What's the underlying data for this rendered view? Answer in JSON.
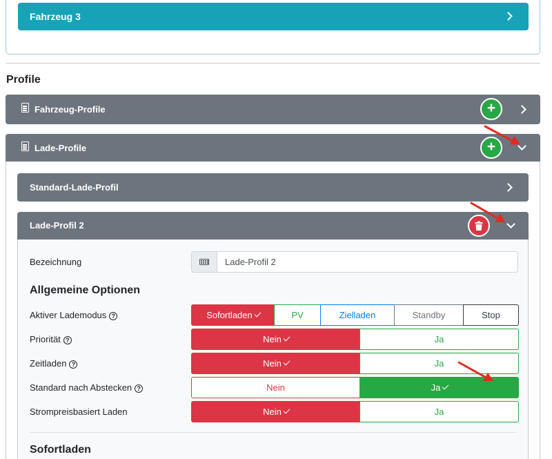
{
  "vehicle": {
    "title": "Fahrzeug 3"
  },
  "profiles_section": {
    "title": "Profile"
  },
  "vehicle_profiles": {
    "title": "Fahrzeug-Profile"
  },
  "charge_profiles": {
    "title": "Lade-Profile"
  },
  "standard_profile": {
    "title": "Standard-Lade-Profil"
  },
  "profile2": {
    "title": "Lade-Profil 2",
    "name_label": "Bezeichnung",
    "name_value": "Lade-Profil 2",
    "general_title": "Allgemeine Optionen",
    "mode": {
      "label": "Aktiver Lademodus",
      "options": [
        "Sofortladen",
        "PV",
        "Zielladen",
        "Standby",
        "Stop"
      ],
      "selected": "Sofortladen"
    },
    "priority": {
      "label": "Priorität",
      "no": "Nein",
      "yes": "Ja",
      "selected": "Nein"
    },
    "time_charging": {
      "label": "Zeitladen",
      "no": "Nein",
      "yes": "Ja",
      "selected": "Nein"
    },
    "default_unplug": {
      "label": "Standard nach Abstecken",
      "no": "Nein",
      "yes": "Ja",
      "selected": "Ja"
    },
    "price_based": {
      "label": "Strompreisbasiert Laden",
      "no": "Nein",
      "yes": "Ja",
      "selected": "Nein"
    },
    "instant_title": "Sofortladen"
  },
  "colors": {
    "info": "#17a2b8",
    "header_gray": "#6c757d",
    "danger": "#dc3545",
    "success": "#28a745",
    "primary": "#007bff",
    "annotation_arrow": "#e8281c"
  }
}
